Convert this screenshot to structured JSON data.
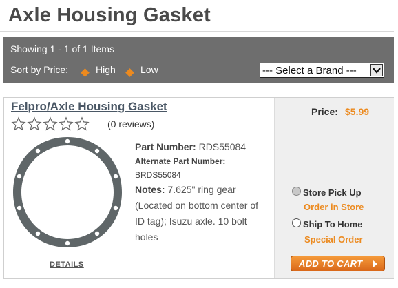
{
  "page": {
    "title": "Axle Housing Gasket"
  },
  "toolbar": {
    "showing": "Showing 1 - 1 of 1 Items",
    "sort_label": "Sort by Price:",
    "sort_high": "High",
    "sort_low": "Low",
    "brand_select": "--- Select a Brand ---"
  },
  "product": {
    "title": "Felpro/Axle Housing Gasket",
    "rating_stars": 0,
    "reviews": "(0 reviews)",
    "part_number_label": "Part Number:",
    "part_number": "RDS55084",
    "alt_part_number_label": "Alternate Part Number:",
    "alt_part_number": "BRDS55084",
    "notes_label": "Notes:",
    "notes": "7.625\" ring gear (Located on bottom center of ID tag); Isuzu axle. 10 bolt holes",
    "details_link": "DETAILS",
    "price_label": "Price:",
    "price": "$5.99",
    "store_pickup_label": "Store Pick Up",
    "store_pickup_sub": "Order in Store",
    "ship_home_label": "Ship To Home",
    "ship_home_sub": "Special Order",
    "add_to_cart": "ADD TO CART"
  },
  "colors": {
    "accent": "#ec8a1f",
    "toolbar_bg": "#6e6e6e",
    "title_text": "#4a4a4a"
  },
  "icons": [
    "diamond-bullet-icon",
    "dropdown-arrow-icon",
    "star-outline-icon",
    "arrow-right-icon"
  ]
}
